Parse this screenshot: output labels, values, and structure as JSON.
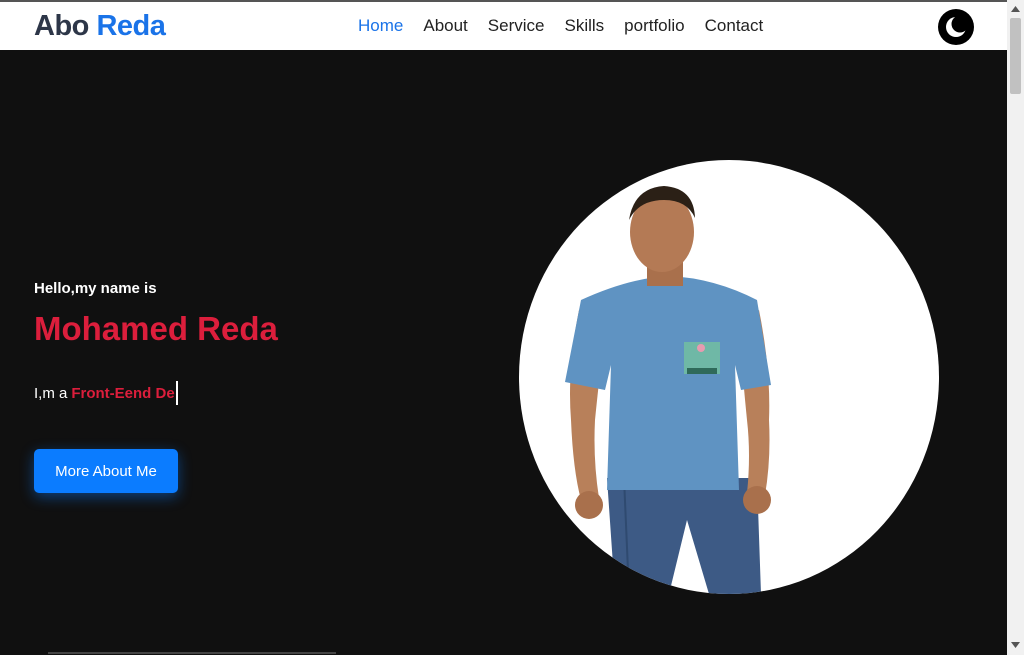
{
  "brand": {
    "first": "Abo",
    "second": "Reda"
  },
  "nav": {
    "items": [
      {
        "label": "Home",
        "active": true
      },
      {
        "label": "About",
        "active": false
      },
      {
        "label": "Service",
        "active": false
      },
      {
        "label": "Skills",
        "active": false
      },
      {
        "label": "portfolio",
        "active": false
      },
      {
        "label": "Contact",
        "active": false
      }
    ],
    "theme_icon": "moon-icon"
  },
  "hero": {
    "greeting": "Hello,my name is",
    "name": "Mohamed Reda",
    "role_prefix": "I,m a",
    "role_typed": "Front-Eend De",
    "cta_label": "More About Me",
    "photo_icon": "person-photo"
  },
  "colors": {
    "accent": "#1a73e8",
    "highlight": "#dc1e3c",
    "button": "#0b7cff",
    "background": "#101010"
  }
}
